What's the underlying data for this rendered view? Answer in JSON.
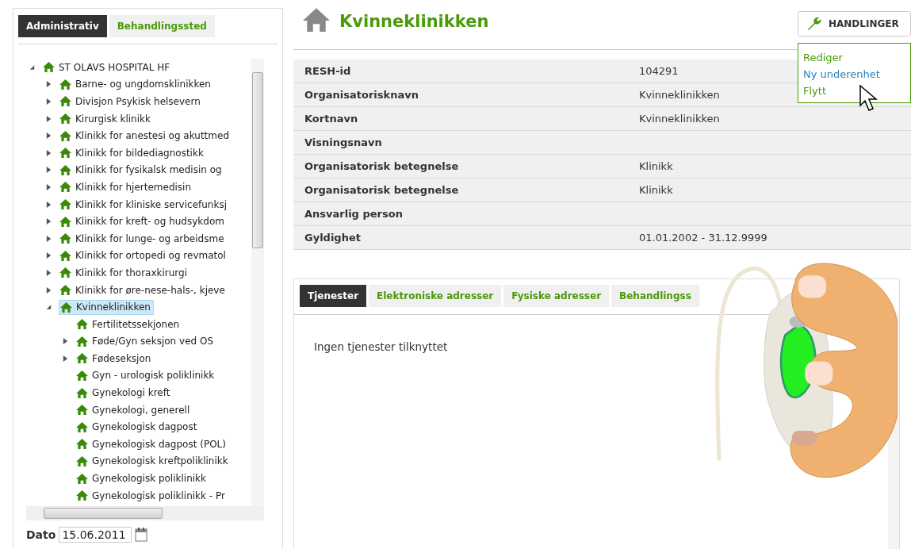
{
  "left_tabs": [
    {
      "label": "Administrativ",
      "selected": true
    },
    {
      "label": "Behandlingssted",
      "selected": false
    }
  ],
  "tree": [
    {
      "label": "ST OLAVS HOSPITAL HF",
      "expanded": true,
      "selected": false,
      "children": [
        {
          "label": "Barne- og ungdomsklinikken",
          "expanded": false,
          "selected": false
        },
        {
          "label": "Divisjon Psykisk helsevern",
          "expanded": false,
          "selected": false
        },
        {
          "label": "Kirurgisk klinikk",
          "expanded": false,
          "selected": false
        },
        {
          "label": "Klinikk for anestesi og akuttmed",
          "expanded": false,
          "selected": false
        },
        {
          "label": "Klinikk for bildediagnostikk",
          "expanded": false,
          "selected": false
        },
        {
          "label": "Klinikk for fysikalsk medisin og",
          "expanded": false,
          "selected": false
        },
        {
          "label": "Klinikk for hjertemedisin",
          "expanded": false,
          "selected": false
        },
        {
          "label": "Klinikk for kliniske servicefunksj",
          "expanded": false,
          "selected": false
        },
        {
          "label": "Klinikk for kreft- og hudsykdom",
          "expanded": false,
          "selected": false
        },
        {
          "label": "Klinikk for lunge- og arbeidsme",
          "expanded": false,
          "selected": false
        },
        {
          "label": "Klinikk for ortopedi og revmatol",
          "expanded": false,
          "selected": false
        },
        {
          "label": "Klinikk for thoraxkirurgi",
          "expanded": false,
          "selected": false
        },
        {
          "label": "Klinikk for øre-nese-hals-, kjeve",
          "expanded": false,
          "selected": false
        },
        {
          "label": "Kvinneklinikken",
          "expanded": true,
          "selected": true,
          "children": [
            {
              "label": "Fertilitetssekjonen",
              "selected": false
            },
            {
              "label": "Føde/Gyn seksjon ved OS",
              "expanded": false,
              "selected": false
            },
            {
              "label": "Fødeseksjon",
              "expanded": false,
              "selected": false
            },
            {
              "label": "Gyn - urologisk poliklinikk",
              "selected": false
            },
            {
              "label": "Gynekologi kreft",
              "selected": false
            },
            {
              "label": "Gynekologi, generell",
              "selected": false
            },
            {
              "label": "Gynekologisk dagpost",
              "selected": false
            },
            {
              "label": "Gynekologisk dagpost (POL)",
              "selected": false
            },
            {
              "label": "Gynekologisk kreftpoliklinikk",
              "selected": false
            },
            {
              "label": "Gynekologisk poliklinikk",
              "selected": false
            },
            {
              "label": "Gynekologisk poliklinikk - Pr",
              "selected": false
            }
          ]
        }
      ]
    }
  ],
  "date": {
    "label": "Dato",
    "value": "15.06.2011"
  },
  "title": "Kvinneklinikken",
  "actions": {
    "label": "HANDLINGER",
    "items": [
      {
        "label": "Rediger",
        "highlighted": false
      },
      {
        "label": "Ny underenhet",
        "highlighted": true
      },
      {
        "label": "Flytt",
        "highlighted": false
      }
    ]
  },
  "details": [
    {
      "label": "RESH-id",
      "value": "104291"
    },
    {
      "label": "Organisatorisknavn",
      "value": "Kvinneklinikken"
    },
    {
      "label": "Kortnavn",
      "value": "Kvinneklinikken"
    },
    {
      "label": "Visningsnavn"
    },
    {
      "label": "Organisatorisk betegnelse",
      "value": "Klinikk"
    },
    {
      "label": "Organisatorisk betegnelse",
      "value": "Klinikk"
    },
    {
      "label": "Ansvarlig person"
    },
    {
      "label": "Gyldighet",
      "value": "01.01.2002 - 31.12.9999"
    }
  ],
  "bottom_tabs": [
    {
      "label": "Tjenester",
      "selected": true
    },
    {
      "label": "Elektroniske adresser",
      "selected": false
    },
    {
      "label": "Fysiske adresser",
      "selected": false
    },
    {
      "label": "Behandlingss",
      "selected": false
    }
  ],
  "empty_message": "Ingen tjenester tilknyttet"
}
